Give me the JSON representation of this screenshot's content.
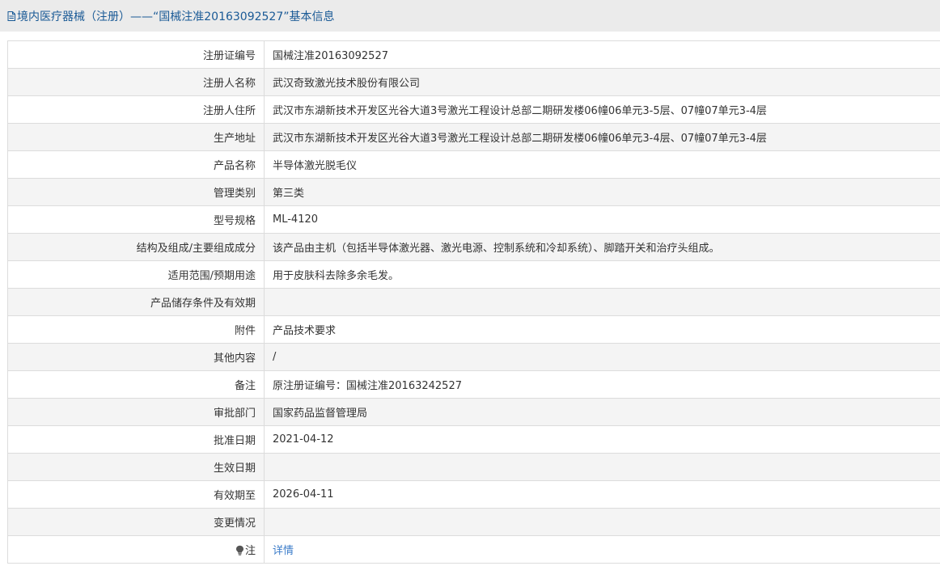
{
  "header": {
    "title": "境内医疗器械（注册）——“国械注准20163092527”基本信息"
  },
  "rows": [
    {
      "label": "注册证编号",
      "value": "国械注准20163092527"
    },
    {
      "label": "注册人名称",
      "value": "武汉奇致激光技术股份有限公司"
    },
    {
      "label": "注册人住所",
      "value": "武汉市东湖新技术开发区光谷大道3号激光工程设计总部二期研发楼06幢06单元3-5层、07幢07单元3-4层"
    },
    {
      "label": "生产地址",
      "value": "武汉市东湖新技术开发区光谷大道3号激光工程设计总部二期研发楼06幢06单元3-4层、07幢07单元3-4层"
    },
    {
      "label": "产品名称",
      "value": "半导体激光脱毛仪"
    },
    {
      "label": "管理类别",
      "value": "第三类"
    },
    {
      "label": "型号规格",
      "value": "ML-4120"
    },
    {
      "label": "结构及组成/主要组成成分",
      "value": "该产品由主机（包括半导体激光器、激光电源、控制系统和冷却系统）、脚踏开关和治疗头组成。"
    },
    {
      "label": "适用范围/预期用途",
      "value": "用于皮肤科去除多余毛发。"
    },
    {
      "label": "产品储存条件及有效期",
      "value": ""
    },
    {
      "label": "附件",
      "value": "产品技术要求"
    },
    {
      "label": "其他内容",
      "value": "/"
    },
    {
      "label": "备注",
      "value": "原注册证编号：国械注准20163242527"
    },
    {
      "label": "审批部门",
      "value": "国家药品监督管理局"
    },
    {
      "label": "批准日期",
      "value": "2021-04-12"
    },
    {
      "label": "生效日期",
      "value": ""
    },
    {
      "label": "有效期至",
      "value": "2026-04-11"
    },
    {
      "label": "变更情况",
      "value": ""
    }
  ],
  "note_row": {
    "label": "注",
    "link_text": "详情",
    "icon": "lightbulb-icon"
  },
  "colors": {
    "header_bg": "#ebebeb",
    "header_text": "#1a5a96",
    "row_alt_bg": "#f4f4f4",
    "border": "#dcdcdc",
    "link": "#3b7cc9"
  }
}
